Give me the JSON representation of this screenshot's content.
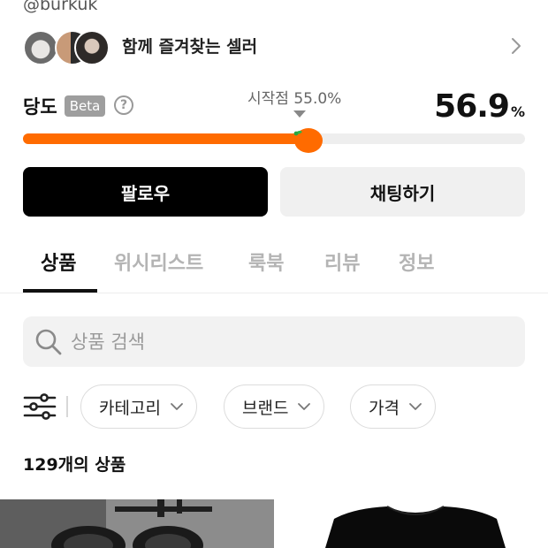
{
  "profile": {
    "handle": "@burkuk"
  },
  "sellers": {
    "label": "함께 즐겨찾는 셀러",
    "avatar_count": 3
  },
  "sweetness": {
    "title": "당도",
    "badge": "Beta",
    "help_glyph": "?",
    "start_label": "시작점 55.0%",
    "start_value": 55.0,
    "value_number": "56.9",
    "value_unit": "%",
    "value": 56.9,
    "accent_color": "#ff6b00"
  },
  "actions": {
    "follow_label": "팔로우",
    "chat_label": "채팅하기"
  },
  "tabs": [
    {
      "label": "상품",
      "active": true
    },
    {
      "label": "위시리스트",
      "active": false
    },
    {
      "label": "룩북",
      "active": false
    },
    {
      "label": "리뷰",
      "active": false
    },
    {
      "label": "정보",
      "active": false
    }
  ],
  "search": {
    "placeholder": "상품 검색"
  },
  "filters": {
    "category_label": "카테고리",
    "brand_label": "브랜드",
    "price_label": "가격"
  },
  "products": {
    "count_number": "129",
    "count_suffix": "개의 상품"
  }
}
